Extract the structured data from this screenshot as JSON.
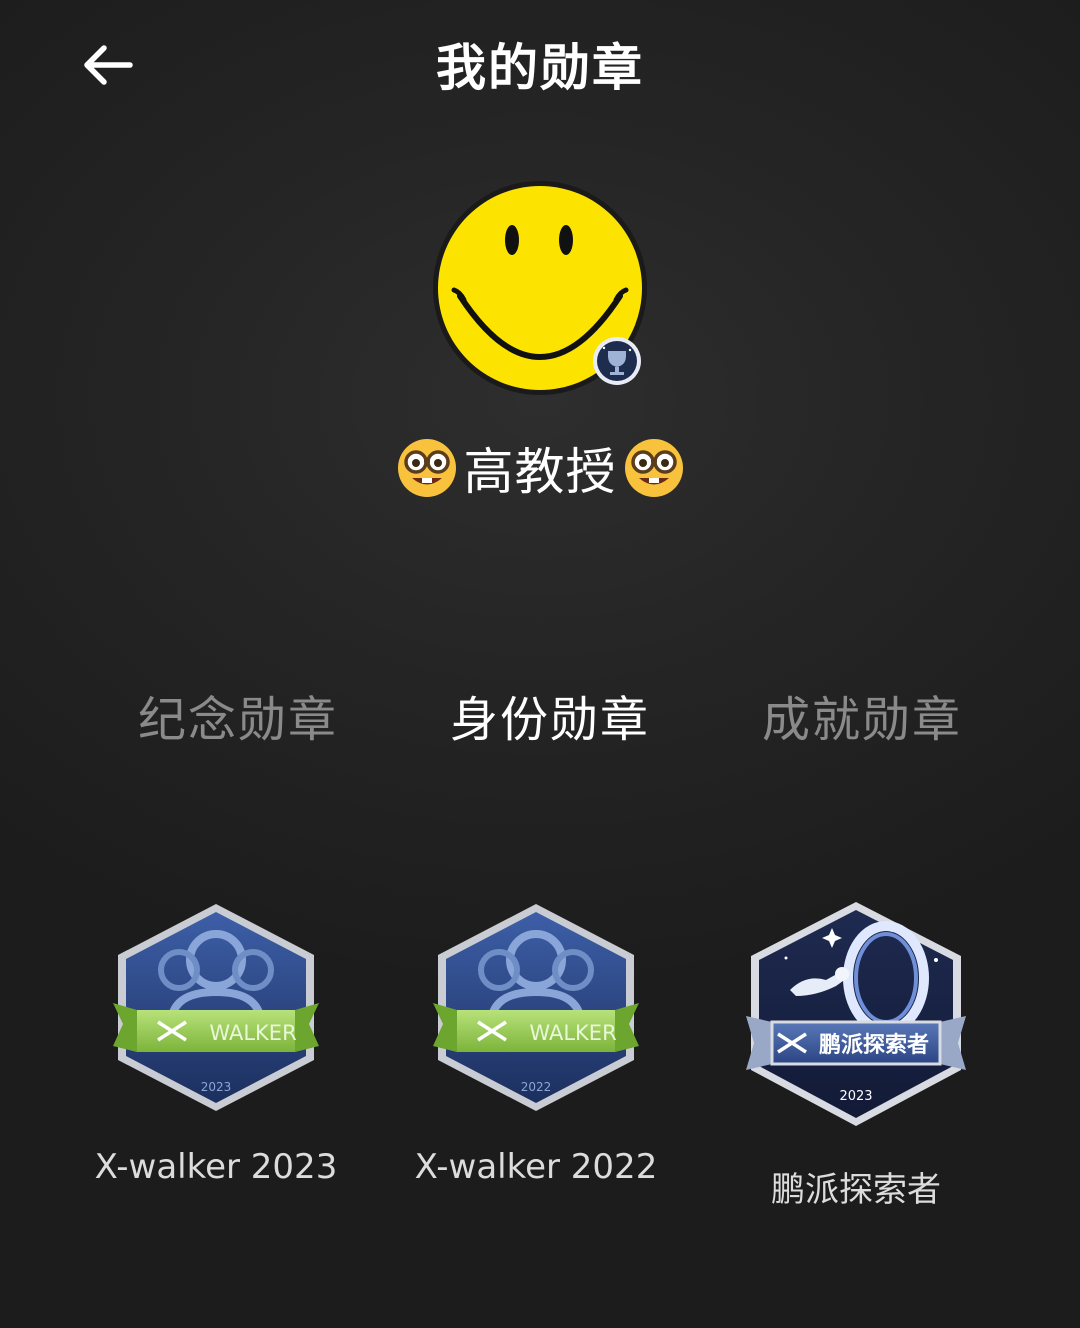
{
  "header": {
    "title": "我的勋章",
    "back_icon": "arrow-left-icon"
  },
  "profile": {
    "avatar_icon": "smiley-face-icon",
    "badge_icon": "trophy-badge-icon",
    "nickname": "高教授",
    "nickname_emoji": "nerd-face-emoji"
  },
  "tabs": [
    {
      "label": "纪念勋章",
      "active": false
    },
    {
      "label": "身份勋章",
      "active": true
    },
    {
      "label": "成就勋章",
      "active": false
    }
  ],
  "badges": [
    {
      "name": "X-walker 2023",
      "ribbon_text": "WALKER",
      "year": "2023",
      "icon": "walker-badge-icon"
    },
    {
      "name": "X-walker 2022",
      "ribbon_text": "WALKER",
      "year": "2022",
      "icon": "walker-badge-icon"
    },
    {
      "name": "鹏派探索者",
      "ribbon_text": "鹏派探索者",
      "year": "2023",
      "icon": "explorer-badge-icon"
    }
  ],
  "colors": {
    "background": "#232323",
    "active_tab": "#ffffff",
    "inactive_tab": "#8a8a8a",
    "ribbon_green": "#8cc84b",
    "badge_blue": "#2a4a8a",
    "smiley_yellow": "#fde400"
  }
}
